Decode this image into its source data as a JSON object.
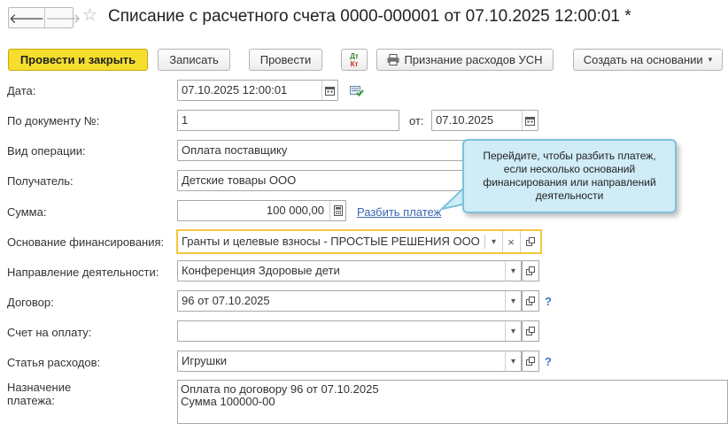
{
  "header": {
    "back_glyph": "🡐",
    "forward_glyph": "🡒",
    "star_glyph": "☆",
    "title": "Списание с расчетного счета 0000-000001 от 07.10.2025 12:00:01 *"
  },
  "toolbar": {
    "post_close": "Провести и закрыть",
    "save": "Записать",
    "post": "Провести",
    "dtkt_top": "Дт",
    "dtkt_bottom": "Кт",
    "usn": "Признание расходов УСН",
    "create_based": "Создать на основании",
    "caret": "▾"
  },
  "form": {
    "date_label": "Дата:",
    "date_value": "07.10.2025 12:00:01",
    "docnum_label": "По документу №:",
    "docnum_value": "1",
    "from_label": "от:",
    "from_value": "07.10.2025",
    "optype_label": "Вид операции:",
    "optype_value": "Оплата поставщику",
    "recipient_label": "Получатель:",
    "recipient_value": "Детские товары ООО",
    "amount_label": "Сумма:",
    "amount_value": "100 000,00",
    "split_link": "Разбить платеж",
    "funding_label": "Основание финансирования:",
    "funding_value": "Гранты и целевые взносы - ПРОСТЫЕ РЕШЕНИЯ ООО",
    "activity_label": "Направление деятельности:",
    "activity_value": "Конференция Здоровые дети",
    "contract_label": "Договор:",
    "contract_value": "96 от 07.10.2025",
    "invoice_label": "Счет на оплату:",
    "invoice_value": "",
    "expense_label": "Статья расходов:",
    "expense_value": "Игрушки",
    "purpose_label_1": "Назначение",
    "purpose_label_2": "платежа:",
    "purpose_line_1": "Оплата по договору 96 от 07.10.2025",
    "purpose_line_2": "Сумма 100000-00",
    "help_glyph": "?",
    "clear_glyph": "×",
    "dd_glyph": "▾"
  },
  "tooltip": {
    "text_1": "Перейдите, чтобы разбить платеж,",
    "text_2": "если несколько оснований",
    "text_3": "финансирования или направлений",
    "text_4": "деятельности"
  }
}
